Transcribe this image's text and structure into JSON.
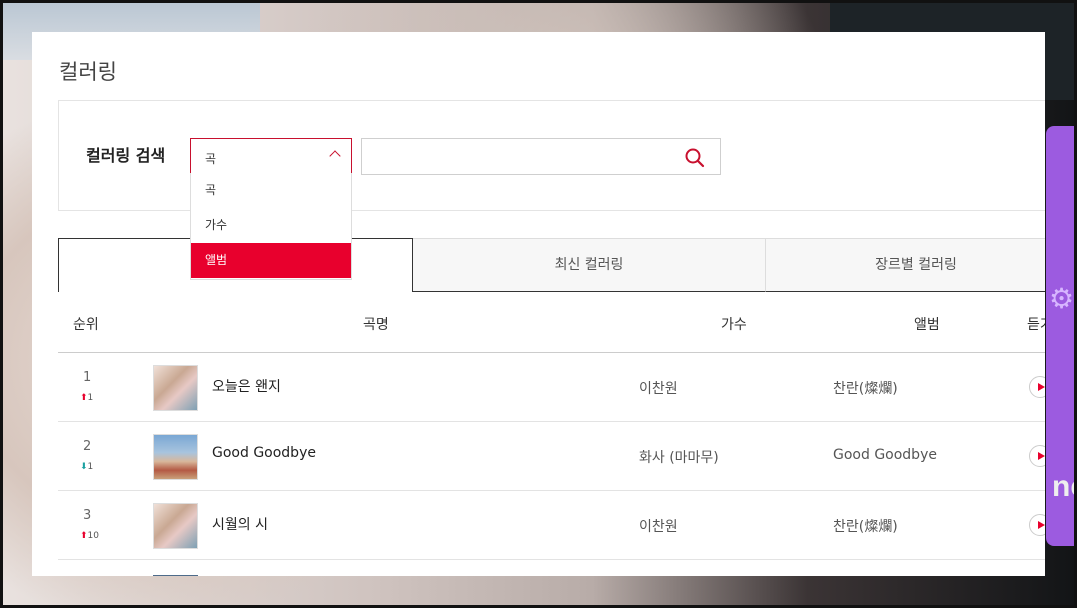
{
  "page_title": "컬러링",
  "search": {
    "label": "컬러링 검색",
    "selected": "곡",
    "input_value": "",
    "options": [
      "곡",
      "가수",
      "앨범"
    ],
    "active_option": "앨범"
  },
  "tabs": [
    {
      "label": ""
    },
    {
      "label": "최신 컬러링"
    },
    {
      "label": "장르별 컬러링"
    }
  ],
  "table": {
    "headers": {
      "rank": "순위",
      "title": "곡명",
      "artist": "가수",
      "album": "앨범",
      "listen": "듣기"
    },
    "rows": [
      {
        "rank": "1",
        "change_dir": "up",
        "change_value": "1",
        "title": "오늘은 왠지",
        "artist": "이찬원",
        "album": "찬란(燦爛)"
      },
      {
        "rank": "2",
        "change_dir": "down",
        "change_value": "1",
        "title": "Good Goodbye",
        "artist": "화사 (마마무)",
        "album": "Good Goodbye"
      },
      {
        "rank": "3",
        "change_dir": "up",
        "change_value": "10",
        "title": "시월의 시",
        "artist": "이찬원",
        "album": "찬란(燦爛)"
      }
    ]
  },
  "colors": {
    "accent": "#e8002d",
    "select_border": "#c8102e",
    "down": "#1ba1a1"
  }
}
